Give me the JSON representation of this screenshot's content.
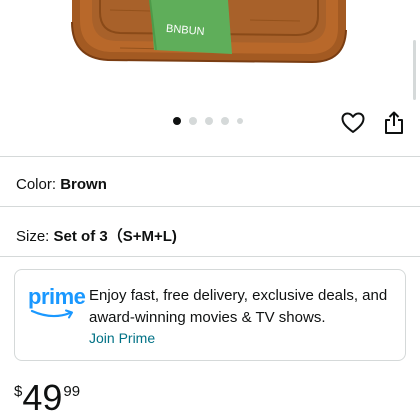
{
  "product": {
    "image_brand_text": "BNBUN",
    "carousel_count": 5,
    "carousel_active_index": 0
  },
  "icons": {
    "favorite": "heart-icon",
    "share": "share-icon"
  },
  "variations": {
    "color_label": "Color:",
    "color_value": "Brown",
    "size_label": "Size:",
    "size_value": "Set of 3（S+M+L)"
  },
  "prime": {
    "logo_text": "prime",
    "description": "Enjoy fast, free delivery, exclusive deals, and award-winning movies & TV shows.",
    "join_link": "Join Prime",
    "brand_color": "#1a98ff",
    "link_color": "#007185"
  },
  "price": {
    "symbol": "$",
    "whole": "49",
    "fraction": "99"
  }
}
